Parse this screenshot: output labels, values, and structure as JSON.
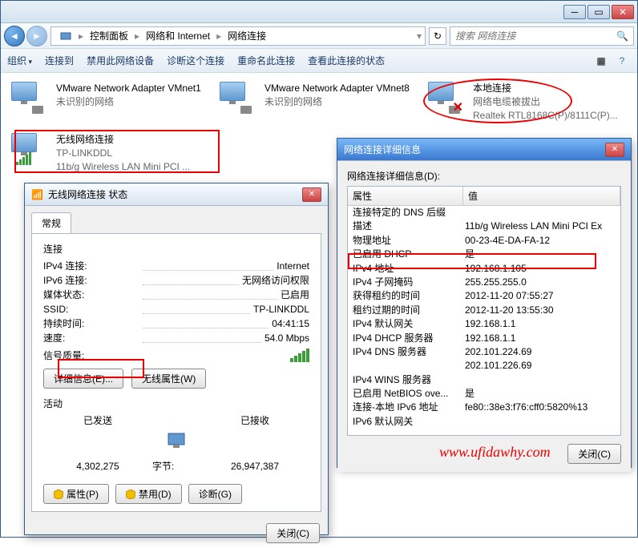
{
  "breadcrumb": {
    "i1": "控制面板",
    "i2": "网络和 Internet",
    "i3": "网络连接"
  },
  "search": {
    "placeholder": "搜索 网络连接"
  },
  "toolbar": {
    "org": "组织",
    "conn": "连接到",
    "disable": "禁用此网络设备",
    "diag": "诊断这个连接",
    "rename": "重命名此连接",
    "status": "查看此连接的状态"
  },
  "adapters": [
    {
      "l1": "VMware Network Adapter VMnet1",
      "l2": "未识别的网络",
      "l3": ""
    },
    {
      "l1": "VMware Network Adapter VMnet8",
      "l2": "未识别的网络",
      "l3": ""
    },
    {
      "l1": "本地连接",
      "l2": "网络电缆被拔出",
      "l3": "Realtek RTL8168C(P)/8111C(P)..."
    },
    {
      "l1": "无线网络连接",
      "l2": "TP-LINKDDL",
      "l3": "11b/g Wireless LAN Mini PCI ..."
    }
  ],
  "status_dlg": {
    "title": "无线网络连接 状态",
    "tab": "常规",
    "sec_conn": "连接",
    "ipv4_k": "IPv4 连接:",
    "ipv4_v": "Internet",
    "ipv6_k": "IPv6 连接:",
    "ipv6_v": "无网络访问权限",
    "media_k": "媒体状态:",
    "media_v": "已启用",
    "ssid_k": "SSID:",
    "ssid_v": "TP-LINKDDL",
    "dur_k": "持续时间:",
    "dur_v": "04:41:15",
    "spd_k": "速度:",
    "spd_v": "54.0 Mbps",
    "sig_k": "信号质量:",
    "btn_details": "详细信息(E)...",
    "btn_wprop": "无线属性(W)",
    "sec_act": "活动",
    "sent": "已发送",
    "recv": "已接收",
    "bytes_k": "字节:",
    "bytes_sent": "4,302,275",
    "bytes_recv": "26,947,387",
    "btn_prop": "属性(P)",
    "btn_disable": "禁用(D)",
    "btn_diag": "诊断(G)",
    "btn_close": "关闭(C)"
  },
  "details_dlg": {
    "title": "网络连接详细信息",
    "label": "网络连接详细信息(D):",
    "col1": "属性",
    "col2": "值",
    "rows": [
      {
        "k": "连接特定的 DNS 后缀",
        "v": ""
      },
      {
        "k": "描述",
        "v": "11b/g Wireless LAN Mini PCI Ex"
      },
      {
        "k": "物理地址",
        "v": "00-23-4E-DA-FA-12"
      },
      {
        "k": "已启用 DHCP",
        "v": "是"
      },
      {
        "k": "IPv4 地址",
        "v": "192.168.1.105"
      },
      {
        "k": "IPv4 子网掩码",
        "v": "255.255.255.0"
      },
      {
        "k": "获得租约的时间",
        "v": "2012-11-20 07:55:27"
      },
      {
        "k": "租约过期的时间",
        "v": "2012-11-20 13:55:30"
      },
      {
        "k": "IPv4 默认网关",
        "v": "192.168.1.1"
      },
      {
        "k": "IPv4 DHCP 服务器",
        "v": "192.168.1.1"
      },
      {
        "k": "IPv4 DNS 服务器",
        "v": "202.101.224.69"
      },
      {
        "k": "",
        "v": "202.101.226.69"
      },
      {
        "k": "IPv4 WINS 服务器",
        "v": ""
      },
      {
        "k": "已启用 NetBIOS ove...",
        "v": "是"
      },
      {
        "k": "连接-本地 IPv6 地址",
        "v": "fe80::38e3:f76:cff0:5820%13"
      },
      {
        "k": "IPv6 默认网关",
        "v": ""
      }
    ],
    "btn_close": "关闭(C)"
  },
  "watermark": "www.ufidawhy.com"
}
